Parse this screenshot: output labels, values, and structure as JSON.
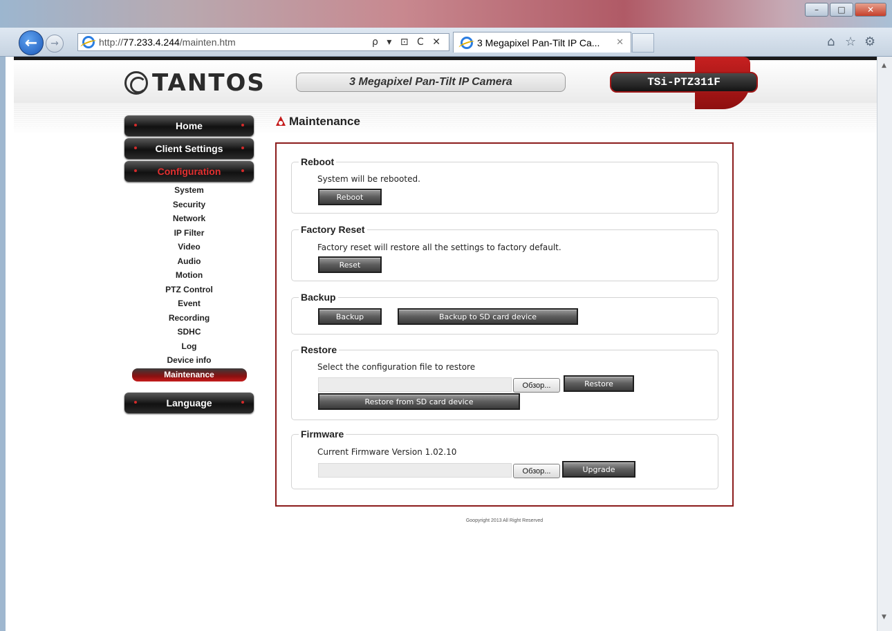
{
  "browser": {
    "url_host": "http://",
    "url_bold": "77.233.4.244",
    "url_path": "/mainten.htm",
    "addr_tools": "ρ ▾ ⊡ C ✕",
    "tab_title": "3 Megapixel Pan-Tilt IP Ca...",
    "tab_close": "✕",
    "win_min": "–",
    "win_max": "□",
    "win_close": "✕",
    "back": "←",
    "forward": "→",
    "home_icon": "⌂",
    "star_icon": "☆",
    "gear_icon": "⚙",
    "scroll_up": "▲",
    "scroll_down": "▼"
  },
  "header": {
    "brand": "TANTOS",
    "product": "3 Megapixel Pan-Tilt IP Camera",
    "model": "TSi-PTZ311F"
  },
  "nav": {
    "home": "Home",
    "client_settings": "Client Settings",
    "configuration": "Configuration",
    "language": "Language",
    "sub_items": [
      "System",
      "Security",
      "Network",
      "IP Filter",
      "Video",
      "Audio",
      "Motion",
      "PTZ Control",
      "Event",
      "Recording",
      "SDHC",
      "Log",
      "Device info"
    ],
    "current": "Maintenance"
  },
  "main": {
    "title": "Maintenance",
    "reboot": {
      "legend": "Reboot",
      "text": "System will be rebooted.",
      "button": "Reboot"
    },
    "factory_reset": {
      "legend": "Factory Reset",
      "text": "Factory reset will restore all the settings to factory default.",
      "button": "Reset"
    },
    "backup": {
      "legend": "Backup",
      "button": "Backup",
      "sd_button": "Backup to SD card device"
    },
    "restore": {
      "legend": "Restore",
      "text": "Select the configuration file to restore",
      "browse": "Обзор...",
      "button": "Restore",
      "sd_button": "Restore from SD card device"
    },
    "firmware": {
      "legend": "Firmware",
      "text": "Current Firmware Version  1.02.10",
      "browse": "Обзор...",
      "button": "Upgrade"
    },
    "copyright": "Goopyright 2013 All Right Reserved"
  },
  "colors": {
    "accent_red": "#c41a1a",
    "panel_border": "#8b1c1c",
    "nav_dark": "#111111"
  }
}
